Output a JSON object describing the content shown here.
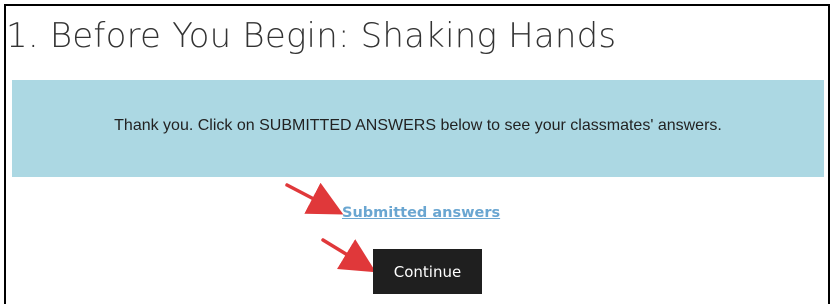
{
  "page": {
    "title": "1. Before You Begin: Shaking Hands"
  },
  "notice": {
    "text": "Thank you. Click on SUBMITTED ANSWERS below to see your classmates' answers."
  },
  "links": {
    "submitted_answers": "Submitted answers"
  },
  "buttons": {
    "continue_label": "Continue"
  },
  "annotations": {
    "arrow_color": "#e0383a",
    "arrows": [
      "pointing-to-submitted-answers",
      "pointing-to-continue"
    ]
  }
}
